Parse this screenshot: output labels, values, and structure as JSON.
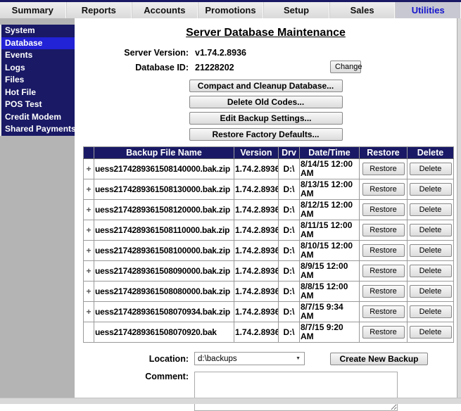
{
  "nav": {
    "items": [
      {
        "label": "Summary",
        "selected": false
      },
      {
        "label": "Reports",
        "selected": false
      },
      {
        "label": "Accounts",
        "selected": false
      },
      {
        "label": "Promotions",
        "selected": false
      },
      {
        "label": "Setup",
        "selected": false
      },
      {
        "label": "Sales",
        "selected": false
      },
      {
        "label": "Utilities",
        "selected": true
      }
    ]
  },
  "sidebar": {
    "items": [
      {
        "label": "System",
        "selected": false
      },
      {
        "label": "Database",
        "selected": true
      },
      {
        "label": "Events",
        "selected": false
      },
      {
        "label": "Logs",
        "selected": false
      },
      {
        "label": "Files",
        "selected": false
      },
      {
        "label": "Hot File",
        "selected": false
      },
      {
        "label": "POS Test",
        "selected": false
      },
      {
        "label": "Credit Modem",
        "selected": false
      },
      {
        "label": "Shared Payments",
        "selected": false
      }
    ]
  },
  "page": {
    "title": "Server Database Maintenance",
    "server_version_label": "Server Version:",
    "server_version": "v1.74.2.8936",
    "database_id_label": "Database ID:",
    "database_id": "21228202",
    "change_button": "Change",
    "action_buttons": [
      "Compact and Cleanup Database...",
      "Delete Old Codes...",
      "Edit Backup Settings...",
      "Restore Factory Defaults..."
    ]
  },
  "backups_table": {
    "headers": [
      "",
      "Backup File Name",
      "Version",
      "Drv",
      "Date/Time",
      "Restore",
      "Delete"
    ],
    "restore_label": "Restore",
    "delete_label": "Delete",
    "expand_glyph": "+",
    "rows": [
      {
        "expandable": true,
        "file": "uess2174289361508140000.bak.zip",
        "version": "1.74.2.8936",
        "drv": "D:\\",
        "datetime": "8/14/15 12:00 AM"
      },
      {
        "expandable": true,
        "file": "uess2174289361508130000.bak.zip",
        "version": "1.74.2.8936",
        "drv": "D:\\",
        "datetime": "8/13/15 12:00 AM"
      },
      {
        "expandable": true,
        "file": "uess2174289361508120000.bak.zip",
        "version": "1.74.2.8936",
        "drv": "D:\\",
        "datetime": "8/12/15 12:00 AM"
      },
      {
        "expandable": true,
        "file": "uess2174289361508110000.bak.zip",
        "version": "1.74.2.8936",
        "drv": "D:\\",
        "datetime": "8/11/15 12:00 AM"
      },
      {
        "expandable": true,
        "file": "uess2174289361508100000.bak.zip",
        "version": "1.74.2.8936",
        "drv": "D:\\",
        "datetime": "8/10/15 12:00 AM"
      },
      {
        "expandable": true,
        "file": "uess2174289361508090000.bak.zip",
        "version": "1.74.2.8936",
        "drv": "D:\\",
        "datetime": "8/9/15 12:00 AM"
      },
      {
        "expandable": true,
        "file": "uess2174289361508080000.bak.zip",
        "version": "1.74.2.8936",
        "drv": "D:\\",
        "datetime": "8/8/15 12:00 AM"
      },
      {
        "expandable": true,
        "file": "uess2174289361508070934.bak.zip",
        "version": "1.74.2.8936",
        "drv": "D:\\",
        "datetime": "8/7/15 9:34 AM"
      },
      {
        "expandable": false,
        "file": "uess2174289361508070920.bak",
        "version": "1.74.2.8936",
        "drv": "D:\\",
        "datetime": "8/7/15 9:20 AM"
      }
    ]
  },
  "footer": {
    "location_label": "Location:",
    "location_value": "d:\\backups",
    "create_backup_button": "Create New Backup",
    "comment_label": "Comment:",
    "comment_value": ""
  },
  "colors": {
    "navy": "#191965",
    "selected_menu_blue": "#2222d6",
    "selected_tab_text": "#1515cc",
    "selected_tab_bg": "#c8c8d2",
    "left_column_gray": "#b4b4b4",
    "table_border": "#9a9a9a"
  }
}
